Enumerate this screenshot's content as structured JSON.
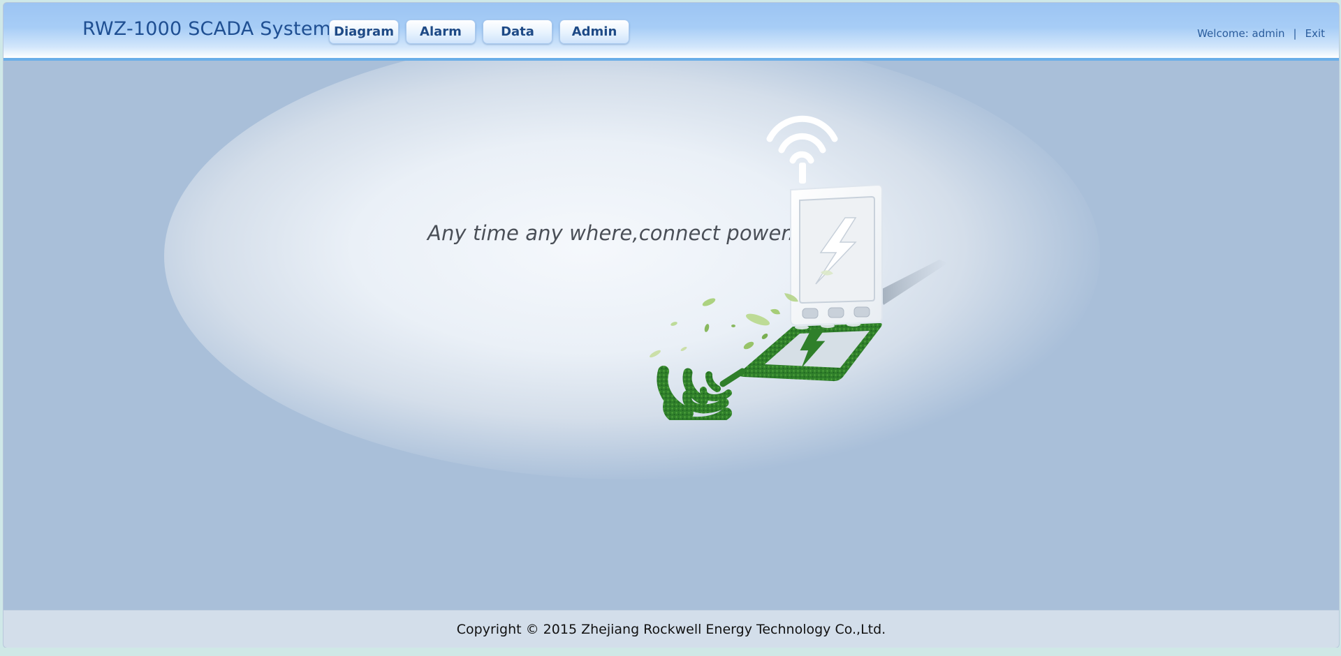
{
  "header": {
    "app_title": "RWZ-1000 SCADA System",
    "nav": [
      {
        "label": "Diagram"
      },
      {
        "label": "Alarm"
      },
      {
        "label": "Data"
      },
      {
        "label": "Admin"
      }
    ],
    "welcome_label": "Welcome: admin",
    "separator": "|",
    "exit_label": "Exit"
  },
  "main": {
    "slogan": "Any time any where,connect power.",
    "illustration": "phone-charging-icon"
  },
  "footer": {
    "copyright": "Copyright © 2015 Zhejiang Rockwell Energy Technology Co.,Ltd."
  },
  "colors": {
    "header_top": "#9cc4f3",
    "header_accent": "#6aaee8",
    "title": "#1f4f92",
    "main_bg": "#a9bfd9",
    "footer_bg": "#d3deea",
    "grass_green": "#2f7f2a"
  }
}
